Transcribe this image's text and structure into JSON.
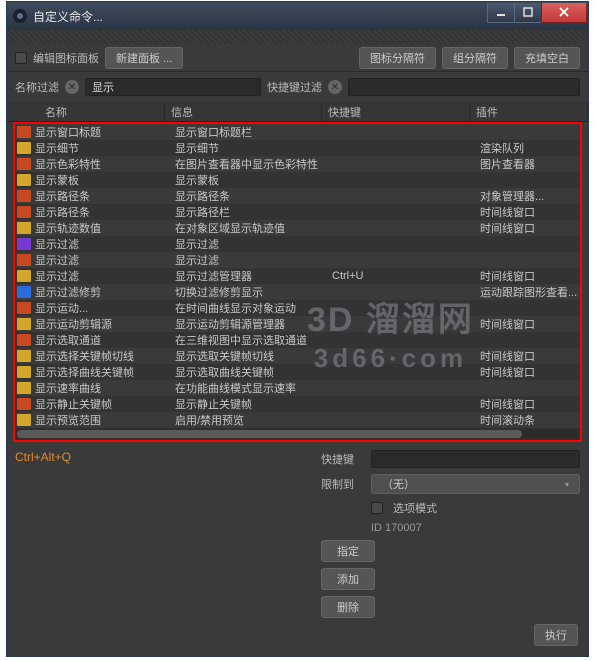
{
  "window": {
    "title": "自定义命令..."
  },
  "toolbar": {
    "edit_label": "编辑图标面板",
    "newpanel_label": "新建面板 ...",
    "icon_sep_label": "图标分隔符",
    "group_sep_label": "组分隔符",
    "fill_blank_label": "充填空白"
  },
  "filters": {
    "name_filter_label": "名称过滤",
    "name_filter_value": "显示",
    "shortcut_filter_label": "快捷键过滤"
  },
  "columns": {
    "name": "名称",
    "info": "信息",
    "key": "快捷键",
    "plugin": "插件"
  },
  "rows": [
    {
      "ico": "a",
      "name": "显示窗口标题",
      "info": "显示窗口标题栏",
      "key": "",
      "plugin": ""
    },
    {
      "ico": "c",
      "name": "显示细节",
      "info": "显示细节",
      "key": "",
      "plugin": "渲染队列"
    },
    {
      "ico": "a",
      "name": "显示色彩特性",
      "info": "在图片查看器中显示色彩特性",
      "key": "",
      "plugin": "图片查看器"
    },
    {
      "ico": "c",
      "name": "显示蒙板",
      "info": "显示蒙板",
      "key": "",
      "plugin": ""
    },
    {
      "ico": "a",
      "name": "显示路径条",
      "info": "显示路径条",
      "key": "",
      "plugin": "对象管理器..."
    },
    {
      "ico": "a",
      "name": "显示路径条",
      "info": "显示路径栏",
      "key": "",
      "plugin": "时间线窗口"
    },
    {
      "ico": "c",
      "name": "显示轨迹数值",
      "info": "在对象区域显示轨迹值",
      "key": "",
      "plugin": "时间线窗口"
    },
    {
      "ico": "d",
      "name": "显示过滤",
      "info": "显示过滤",
      "key": "",
      "plugin": ""
    },
    {
      "ico": "a",
      "name": "显示过滤",
      "info": "显示过滤",
      "key": "",
      "plugin": ""
    },
    {
      "ico": "c",
      "name": "显示过滤",
      "info": "显示过滤管理器",
      "key": "Ctrl+U",
      "plugin": "时间线窗口"
    },
    {
      "ico": "b",
      "name": "显示过滤修剪",
      "info": "切换过滤修剪显示",
      "key": "",
      "plugin": "运动跟踪图形查看..."
    },
    {
      "ico": "a",
      "name": "显示运动...",
      "info": "在时间曲线显示对象运动",
      "key": "",
      "plugin": ""
    },
    {
      "ico": "c",
      "name": "显示运动剪辑源",
      "info": "显示运动剪辑源管理器",
      "key": "",
      "plugin": "时间线窗口"
    },
    {
      "ico": "a",
      "name": "显示选取通道",
      "info": "在三维视图中显示选取通道",
      "key": "",
      "plugin": ""
    },
    {
      "ico": "c",
      "name": "显示选择关键帧切线",
      "info": "显示选取关键帧切线",
      "key": "",
      "plugin": "时间线窗口"
    },
    {
      "ico": "c",
      "name": "显示选择曲线关键帧",
      "info": "显示选取曲线关键帧",
      "key": "",
      "plugin": "时间线窗口"
    },
    {
      "ico": "c",
      "name": "显示速率曲线",
      "info": "在功能曲线模式显示速率",
      "key": "",
      "plugin": ""
    },
    {
      "ico": "a",
      "name": "显示静止关键帧",
      "info": "显示静止关键帧",
      "key": "",
      "plugin": "时间线窗口"
    },
    {
      "ico": "c",
      "name": "显示预览范围",
      "info": "启用/禁用预览",
      "key": "",
      "plugin": "时间滚动条"
    }
  ],
  "bottom": {
    "shortcut_title": "Ctrl+Alt+Q",
    "shortcut_label": "快捷键",
    "limit_label": "限制到",
    "limit_value": "（无）",
    "option_mode": "选项模式",
    "id_label": "ID 170007",
    "assign_btn": "指定",
    "add_btn": "添加",
    "delete_btn": "删除",
    "exec_btn": "执行"
  },
  "watermark": {
    "l1": "3D 溜溜网",
    "l2": "3d66·com"
  }
}
